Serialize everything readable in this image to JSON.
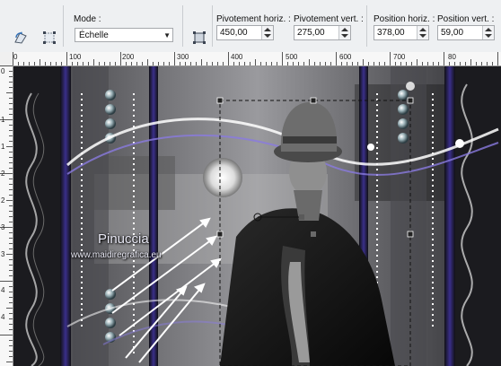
{
  "toolbar": {
    "mode_label": "Mode :",
    "mode_value": "Échelle",
    "fields": [
      {
        "label": "Pivotement horiz. :",
        "value": "450,00"
      },
      {
        "label": "Pivotement vert. :",
        "value": "275,00"
      },
      {
        "label": "Position horiz. :",
        "value": "378,00"
      },
      {
        "label": "Position vert. :",
        "value": "59,00"
      }
    ]
  },
  "ruler": {
    "h_ticks": [
      "0",
      "100",
      "200",
      "300",
      "400",
      "500",
      "600",
      "700",
      "80"
    ],
    "v_ticks": [
      "0",
      "1",
      "1",
      "2",
      "2",
      "3",
      "3",
      "4",
      "4"
    ]
  },
  "artwork": {
    "watermark_name": "Pinuccia",
    "watermark_site": "www.maidiregrafica.eu"
  },
  "colors": {
    "toolbar_bg": "#eef0f2",
    "canvas_dark": "#1c1c20",
    "accent_purple": "#4b3aa8",
    "selection_line": "#111111"
  },
  "icons": [
    "reset-transform-icon",
    "free-transform-icon",
    "pick-tool-icon"
  ]
}
